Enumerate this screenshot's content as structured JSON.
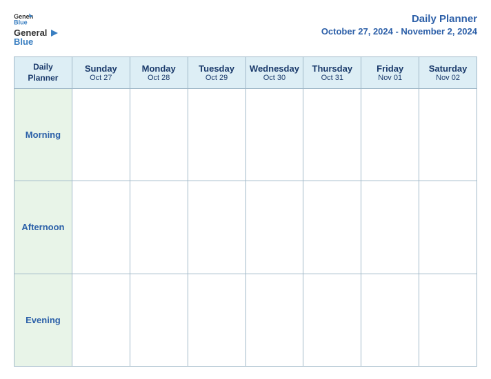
{
  "header": {
    "logo": {
      "line1": "General",
      "line2": "Blue"
    },
    "title": "Daily Planner",
    "date_range": "October 27, 2024 - November 2, 2024"
  },
  "table": {
    "corner_label_line1": "Daily",
    "corner_label_line2": "Planner",
    "columns": [
      {
        "day": "Sunday",
        "date": "Oct 27"
      },
      {
        "day": "Monday",
        "date": "Oct 28"
      },
      {
        "day": "Tuesday",
        "date": "Oct 29"
      },
      {
        "day": "Wednesday",
        "date": "Oct 30"
      },
      {
        "day": "Thursday",
        "date": "Oct 31"
      },
      {
        "day": "Friday",
        "date": "Nov 01"
      },
      {
        "day": "Saturday",
        "date": "Nov 02"
      }
    ],
    "rows": [
      {
        "label": "Morning"
      },
      {
        "label": "Afternoon"
      },
      {
        "label": "Evening"
      }
    ]
  }
}
